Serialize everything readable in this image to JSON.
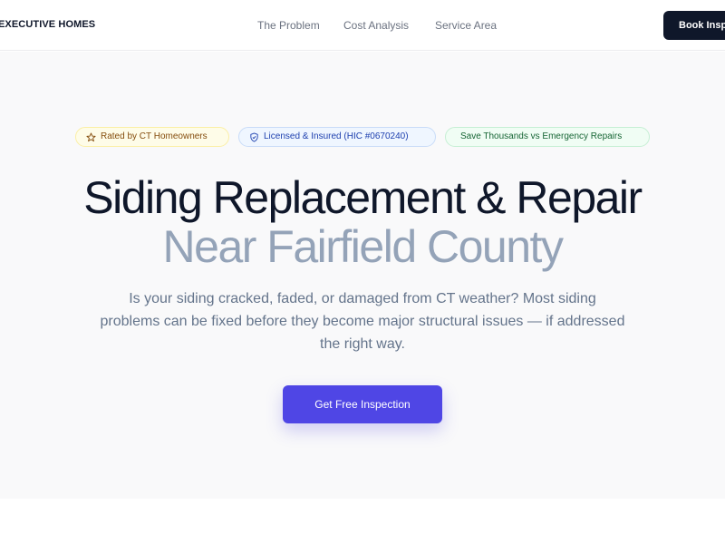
{
  "nav": {
    "logo": "EXECUTIVE HOMES",
    "links": [
      "The Problem",
      "Cost Analysis",
      "Service Area"
    ],
    "cta_label": "Book Inspection"
  },
  "hero": {
    "badges": [
      {
        "label": "Rated by CT Homeowners",
        "icon": "star-icon"
      },
      {
        "label": "Licensed & Insured (HIC #0670240)",
        "icon": "shield-check-icon"
      },
      {
        "label": "Save Thousands vs Emergency Repairs",
        "icon": ""
      }
    ],
    "title_line1": "Siding Replacement & Repair",
    "title_line2": "Near Fairfield County",
    "subtitle": "Is your siding cracked, faded, or damaged from CT weather? Most siding problems can be fixed before they become major structural issues — if addressed the right way.",
    "cta_label": "Get Free Inspection"
  },
  "colors": {
    "accent": "#4f46e5",
    "dark": "#0f172a",
    "muted_title": "#94a3b8"
  }
}
